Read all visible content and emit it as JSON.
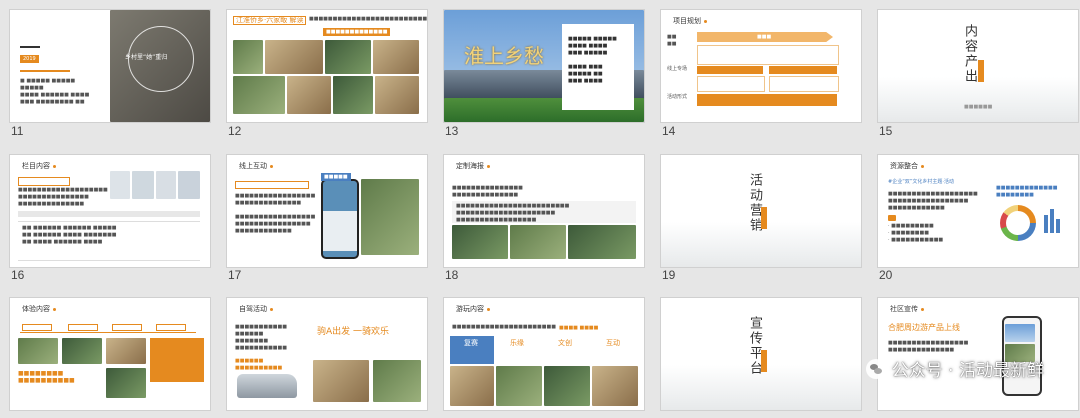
{
  "slides": [
    {
      "num": "11",
      "texts": [
        "乡村里“她”重归"
      ]
    },
    {
      "num": "12",
      "texts": [
        "江淮侨乡·六家畈 解读"
      ]
    },
    {
      "num": "13",
      "texts": [
        "淮上乡愁"
      ]
    },
    {
      "num": "14",
      "texts": [
        "项目规划",
        "线上专场",
        "活动形式"
      ]
    },
    {
      "num": "15",
      "texts": [
        "内容产出"
      ]
    },
    {
      "num": "16",
      "texts": [
        "栏目内容"
      ]
    },
    {
      "num": "17",
      "texts": [
        "线上互动"
      ]
    },
    {
      "num": "18",
      "texts": [
        "定制海报"
      ]
    },
    {
      "num": "19",
      "texts": [
        "活动营销"
      ]
    },
    {
      "num": "20",
      "texts": [
        "资源整合",
        "#企业“双”文化乡村主题·活动"
      ]
    },
    {
      "num": "21",
      "texts": [
        "体验内容"
      ]
    },
    {
      "num": "22",
      "texts": [
        "自驾活动",
        "驹A出发 一骑欢乐"
      ]
    },
    {
      "num": "23",
      "texts": [
        "游玩内容",
        "复赛",
        "乐缘",
        "文创",
        "互动"
      ]
    },
    {
      "num": "24",
      "texts": [
        "宣传平台"
      ]
    },
    {
      "num": "25",
      "texts": [
        "社区宣传",
        "合肥周边游产品上线"
      ]
    }
  ],
  "watermark": {
    "text": "公众号 · 活动最新鲜",
    "icon": "wechat-icon"
  },
  "colors": {
    "accent": "#e58a1f",
    "page_bg": "#e6e6e6"
  }
}
